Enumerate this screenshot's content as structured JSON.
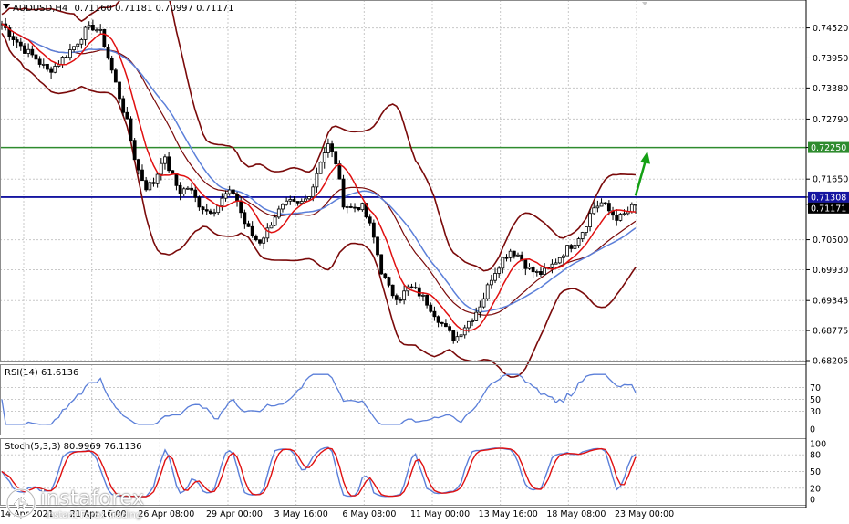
{
  "title_bar": {
    "symbol_label": "AUDUSD,H4",
    "ohlc": "0.71160 0.71181 0.70997 0.71171"
  },
  "colors": {
    "bb": "#7a0a0a",
    "ma_red": "#e01010",
    "ma_blue": "#5b7fd9",
    "h_green": "#2e8b2e",
    "h_blue": "#1515a0",
    "arrow": "#14a014",
    "rsi": "#5b7fd9",
    "stoch_main": "#5b7fd9",
    "stoch_signal": "#e01010",
    "tag_green": "#2e8b2e",
    "tag_blue": "#1515a0",
    "tag_black": "#000000"
  },
  "price_axis": {
    "ticks": [
      "0.74520",
      "0.73950",
      "0.73380",
      "0.72790",
      "0.72250",
      "0.71650",
      "0.71308",
      "0.71171",
      "0.70500",
      "0.69930",
      "0.69345",
      "0.68775",
      "0.68205"
    ]
  },
  "rsi_panel": {
    "label": "RSI(14) 61.6136",
    "ticks": [
      "70",
      "50",
      "30",
      "0"
    ]
  },
  "stoch_panel": {
    "label": "Stoch(5,3,3) 80.9969 76.1136",
    "ticks": [
      "100",
      "80",
      "50",
      "20",
      "0"
    ]
  },
  "x_axis": {
    "labels": [
      "14 Apr 2021",
      "21 Apr 16:00",
      "26 Apr 08:00",
      "29 Apr 00:00",
      "3 May 16:00",
      "6 May 08:00",
      "11 May 00:00",
      "13 May 16:00",
      "18 May 08:00",
      "23 May 00:00"
    ]
  },
  "watermark": {
    "brand": "instaforex",
    "sub": "Instant Forex Trading"
  },
  "chart_data": {
    "type": "candlestick",
    "symbol": "AUDUSD",
    "timeframe": "H4",
    "ohlc_last": {
      "open": 0.7116,
      "high": 0.71181,
      "low": 0.70997,
      "close": 0.71171
    },
    "ylim": [
      0.68205,
      0.7505
    ],
    "horizontal_levels": [
      {
        "value": 0.7225,
        "color": "green"
      },
      {
        "value": 0.71308,
        "color": "blue"
      }
    ],
    "arrow": {
      "direction": "up",
      "from": 0.713,
      "to": 0.7225
    },
    "close_path": [
      [
        0,
        0.746
      ],
      [
        0.7,
        0.7435
      ],
      [
        1.5,
        0.741
      ],
      [
        2.2,
        0.7395
      ],
      [
        3,
        0.737
      ],
      [
        3.5,
        0.738
      ],
      [
        4,
        0.7395
      ],
      [
        4.8,
        0.742
      ],
      [
        5.4,
        0.7445
      ],
      [
        6,
        0.7455
      ],
      [
        6.5,
        0.744
      ],
      [
        7,
        0.739
      ],
      [
        7.6,
        0.733
      ],
      [
        8.2,
        0.727
      ],
      [
        8.8,
        0.719
      ],
      [
        9.4,
        0.715
      ],
      [
        10,
        0.716
      ],
      [
        10.5,
        0.721
      ],
      [
        11,
        0.718
      ],
      [
        11.6,
        0.714
      ],
      [
        12.2,
        0.715
      ],
      [
        12.8,
        0.712
      ],
      [
        13.4,
        0.7105
      ],
      [
        14,
        0.711
      ],
      [
        14.6,
        0.7135
      ],
      [
        15.2,
        0.714
      ],
      [
        15.8,
        0.7085
      ],
      [
        16.3,
        0.706
      ],
      [
        16.8,
        0.7045
      ],
      [
        17.3,
        0.7065
      ],
      [
        17.8,
        0.7095
      ],
      [
        18.3,
        0.711
      ],
      [
        18.8,
        0.712
      ],
      [
        19.3,
        0.7115
      ],
      [
        19.8,
        0.7125
      ],
      [
        20.3,
        0.715
      ],
      [
        20.8,
        0.72
      ],
      [
        21.3,
        0.723
      ],
      [
        21.8,
        0.72
      ],
      [
        22.3,
        0.712
      ],
      [
        22.8,
        0.711
      ],
      [
        23.5,
        0.7115
      ],
      [
        24.2,
        0.7065
      ],
      [
        24.8,
        0.699
      ],
      [
        25.4,
        0.695
      ],
      [
        26,
        0.694
      ],
      [
        26.6,
        0.696
      ],
      [
        27.2,
        0.695
      ],
      [
        27.8,
        0.693
      ],
      [
        28.4,
        0.6905
      ],
      [
        29,
        0.688
      ],
      [
        29.6,
        0.686
      ],
      [
        30.2,
        0.6885
      ],
      [
        30.8,
        0.6905
      ],
      [
        31.4,
        0.6935
      ],
      [
        32,
        0.698
      ],
      [
        32.6,
        0.701
      ],
      [
        33.2,
        0.703
      ],
      [
        33.8,
        0.702
      ],
      [
        34.4,
        0.6995
      ],
      [
        35,
        0.6985
      ],
      [
        35.6,
        0.699
      ],
      [
        36.2,
        0.701
      ],
      [
        36.8,
        0.703
      ],
      [
        37.4,
        0.7045
      ],
      [
        38,
        0.707
      ],
      [
        38.6,
        0.711
      ],
      [
        39.2,
        0.712
      ],
      [
        39.8,
        0.71
      ],
      [
        40.3,
        0.709
      ],
      [
        40.8,
        0.71
      ],
      [
        41.4,
        0.7117
      ]
    ],
    "rsi": {
      "range": [
        0,
        100
      ],
      "last": 61.6136
    },
    "stochastic": {
      "range": [
        0,
        100
      ],
      "main_last": 80.9969,
      "signal_last": 76.1136
    }
  }
}
